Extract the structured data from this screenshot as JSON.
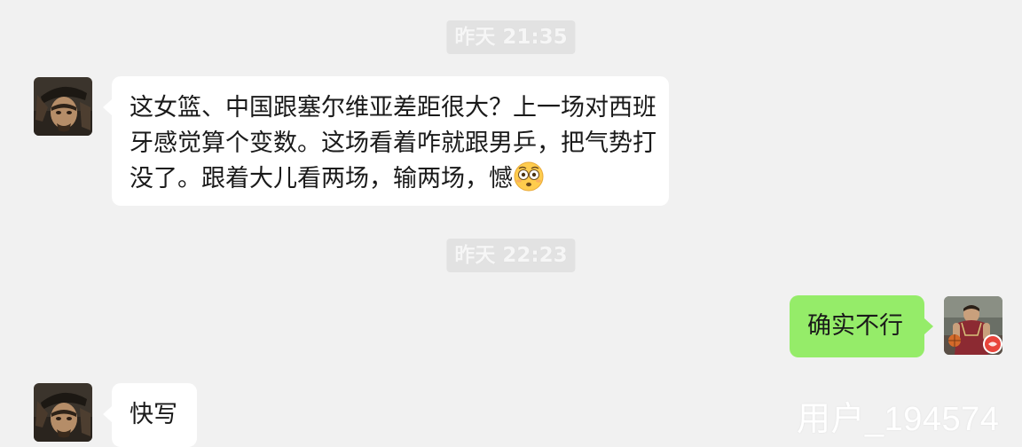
{
  "colors": {
    "background": "#f1f1f1",
    "timestamp_bg": "#e2e2e2",
    "incoming_bubble": "#ffffff",
    "outgoing_bubble": "#95ec69",
    "text": "#1a1a1a"
  },
  "conversation": {
    "timestamps": [
      "昨天 21:35",
      "昨天 22:23"
    ],
    "messages": [
      {
        "sender": "contact",
        "text": "这女篮、中国跟塞尔维亚差距很大？上一场对西班牙感觉算个变数。这场看着咋就跟男乒，把气势打没了。跟着大儿看两场，输两场，憾",
        "emoji": "flushed-face-icon"
      },
      {
        "sender": "self",
        "text": "确实不行"
      },
      {
        "sender": "contact",
        "text": "快写"
      }
    ]
  },
  "avatars": {
    "contact": "pirate-avatar",
    "self": "basketball-player-avatar"
  },
  "watermark": "用户_194574"
}
